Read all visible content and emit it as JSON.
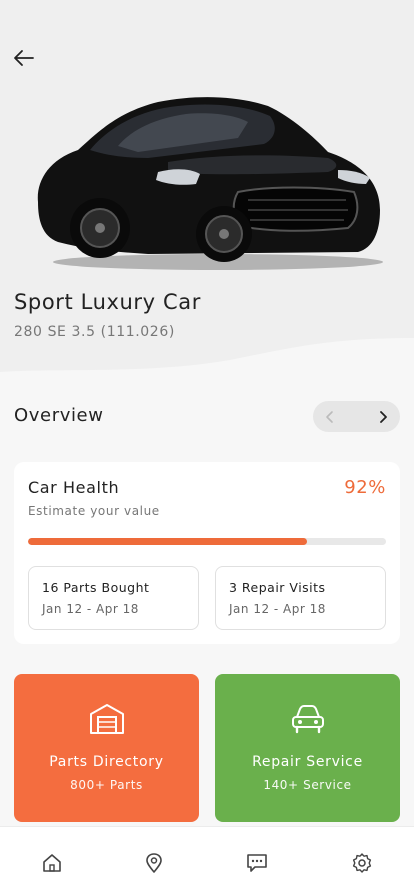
{
  "header": {
    "title": "Sport Luxury Car",
    "subtitle": "280 SE 3.5 (111.026)"
  },
  "overview": {
    "title": "Overview"
  },
  "health": {
    "title": "Car Health",
    "percent_label": "92%",
    "subtitle": "Estimate your value",
    "progress_fraction": 0.78
  },
  "stats": [
    {
      "label": "16 Parts Bought",
      "range": "Jan 12 - Apr 18"
    },
    {
      "label": "3 Repair Visits",
      "range": "Jan 12 - Apr 18"
    }
  ],
  "tiles": [
    {
      "title": "Parts Directory",
      "subtitle": "800+ Parts",
      "icon": "garage-icon",
      "color": "#f46d3f"
    },
    {
      "title": "Repair Service",
      "subtitle": "140+ Service",
      "icon": "car-icon",
      "color": "#6ab04c"
    }
  ],
  "tabs": [
    {
      "icon": "home-icon"
    },
    {
      "icon": "location-pin-icon"
    },
    {
      "icon": "chat-icon"
    },
    {
      "icon": "gear-icon"
    }
  ],
  "colors": {
    "accent": "#ee6b3a",
    "green": "#6ab04c"
  }
}
